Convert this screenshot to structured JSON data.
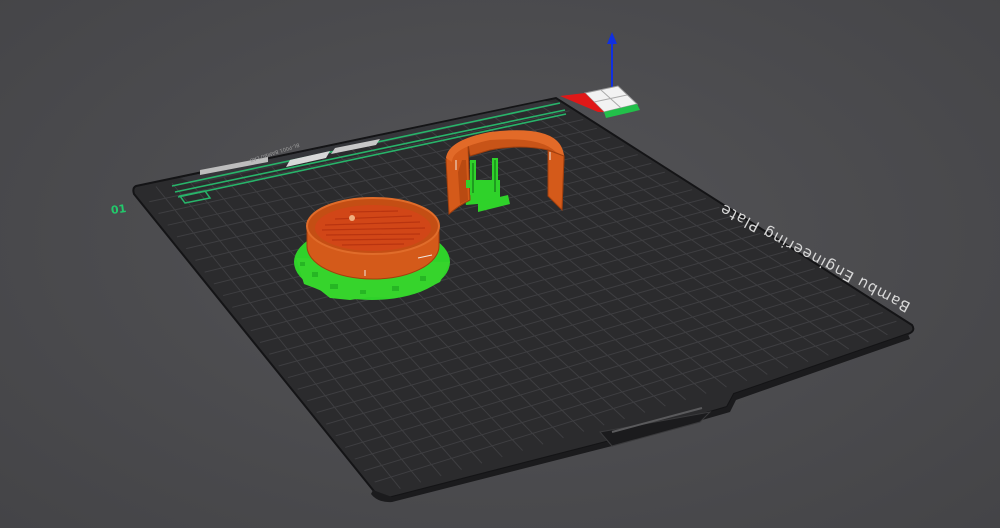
{
  "viewport": {
    "background": "#4a4a4d",
    "plate": {
      "name": "Bambu Engineering Plate",
      "color": "#2b2b2d",
      "grid_color": "#3d3d40",
      "plate_number": "01",
      "small_print": "BL-P001  BAMBU LAB"
    },
    "axes_colors": {
      "x": "#e01818",
      "y": "#20c040",
      "z": "#1030e0"
    },
    "objects": [
      {
        "name": "round-dish",
        "color": "#d45a1a",
        "support_color": "#2fd22a"
      },
      {
        "name": "curved-wall-part",
        "color": "#d45a1a",
        "support_color": "#2fd22a"
      }
    ],
    "icons": [
      "view-cube-icon",
      "z-axis-arrow-icon"
    ]
  }
}
